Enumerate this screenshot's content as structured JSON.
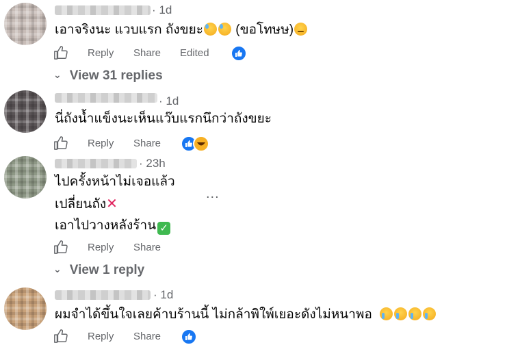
{
  "comments": [
    {
      "time": "1d",
      "lines": [
        "เอาจริงนะ แวบแรก ถังขยะ",
        " (ขอโทษษ)"
      ],
      "actions": {
        "like": "Reply",
        "share": "Share",
        "edited": "Edited"
      },
      "avatar_colors": [
        "#c7c7c7",
        "#a89a95"
      ]
    },
    {
      "time": "1d",
      "lines": [
        "นี่ถังน้ำแข็งนะเห็นแว๊บแรกนึกว่าถังขยะ"
      ],
      "actions": {
        "reply": "Reply",
        "share": "Share"
      },
      "avatar_colors": [
        "#8fa0b0",
        "#3a2f2f"
      ]
    },
    {
      "time": "23h",
      "lines": [
        "ไปครั้งหน้าไม่เจอแล้ว",
        "เปลี่ยนถัง",
        "เอาไปวางหลังร้าน"
      ],
      "actions": {
        "reply": "Reply",
        "share": "Share"
      },
      "avatar_colors": [
        "#b9c0b0",
        "#7f8a78"
      ]
    },
    {
      "time": "1d",
      "lines": [
        "ผมจำได้ขึ้นใจเลยค้าบร้านนี้ ไม่กล้าพิใพ์เยอะดังไม่หนาพอ"
      ],
      "actions": {
        "reply": "Reply",
        "share": "Share"
      },
      "avatar_colors": [
        "#e8d0a8",
        "#6b4e2f"
      ]
    }
  ],
  "view_replies_1": "View 31 replies",
  "view_replies_3": "View 1 reply",
  "dots": "...",
  "icons": {
    "like": "thumbs-up-icon",
    "reaction_like": "facebook-like-reaction-icon",
    "reaction_haha": "haha-reaction-icon",
    "chevron": "chevron-down-icon"
  },
  "colors": {
    "meta_text": "#65676b",
    "fb_blue": "#1877f2"
  }
}
